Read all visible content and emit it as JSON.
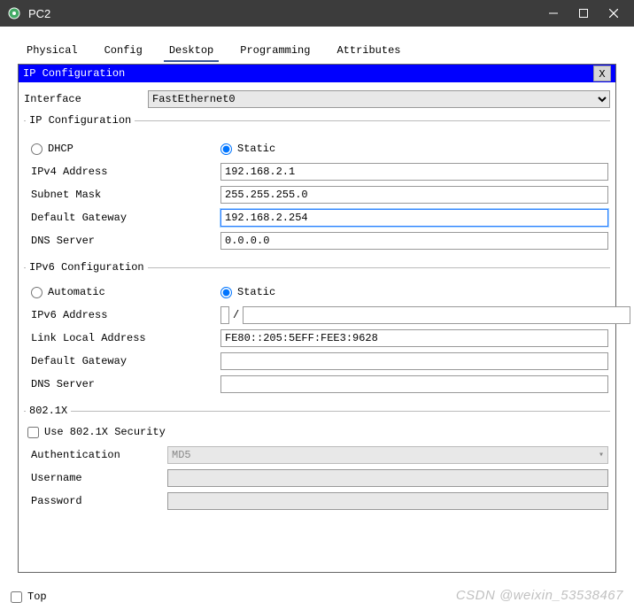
{
  "window": {
    "title": "PC2"
  },
  "tabs": {
    "physical": "Physical",
    "config": "Config",
    "desktop": "Desktop",
    "programming": "Programming",
    "attributes": "Attributes"
  },
  "dialog": {
    "title": "IP Configuration",
    "close": "X"
  },
  "interface": {
    "label": "Interface",
    "value": "FastEthernet0"
  },
  "ipconfig": {
    "legend": "IP Configuration",
    "dhcp": "DHCP",
    "static": "Static",
    "ipv4_label": "IPv4 Address",
    "ipv4_value": "192.168.2.1",
    "subnet_label": "Subnet Mask",
    "subnet_value": "255.255.255.0",
    "gateway_label": "Default Gateway",
    "gateway_value": "192.168.2.254",
    "dns_label": "DNS Server",
    "dns_value": "0.0.0.0"
  },
  "ipv6": {
    "legend": "IPv6 Configuration",
    "automatic": "Automatic",
    "static": "Static",
    "addr_label": "IPv6 Address",
    "addr_value": "",
    "prefix_value": "",
    "slash": "/",
    "lla_label": "Link Local Address",
    "lla_value": "FE80::205:5EFF:FEE3:9628",
    "gateway_label": "Default Gateway",
    "gateway_value": "",
    "dns_label": "DNS Server",
    "dns_value": ""
  },
  "dot1x": {
    "legend": "802.1X",
    "use_label": "Use 802.1X Security",
    "auth_label": "Authentication",
    "auth_value": "MD5",
    "user_label": "Username",
    "user_value": "",
    "pass_label": "Password",
    "pass_value": ""
  },
  "bottom": {
    "top": "Top"
  },
  "watermark": "CSDN @weixin_53538467"
}
